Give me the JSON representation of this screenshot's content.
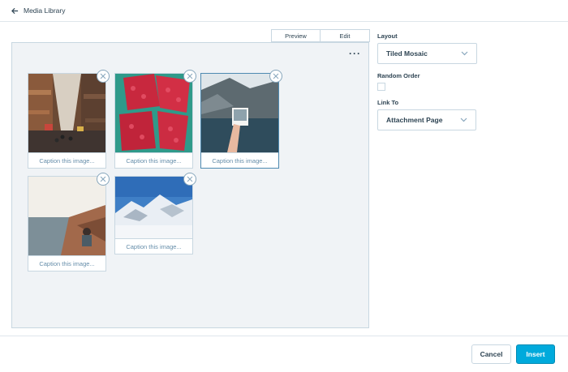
{
  "header": {
    "back_label": "Media Library"
  },
  "tabs": [
    {
      "label": "Preview"
    },
    {
      "label": "Edit"
    }
  ],
  "gallery": {
    "images": [
      {
        "caption_placeholder": "Caption this image...",
        "subject": "narrow-street-photo"
      },
      {
        "caption_placeholder": "Caption this image...",
        "subject": "raspberries-photo"
      },
      {
        "caption_placeholder": "Caption this image...",
        "subject": "lake-polaroid-photo"
      },
      {
        "caption_placeholder": "Caption this image...",
        "subject": "sea-cliff-photo"
      },
      {
        "caption_placeholder": "Caption this image...",
        "subject": "snow-mountain-photo"
      }
    ]
  },
  "settings": {
    "layout_label": "Layout",
    "layout_value": "Tiled Mosaic",
    "random_order_label": "Random Order",
    "random_order_checked": false,
    "link_to_label": "Link To",
    "link_to_value": "Attachment Page"
  },
  "footer": {
    "cancel_label": "Cancel",
    "insert_label": "Insert"
  },
  "colors": {
    "accent": "#00aadc",
    "text": "#2e4453",
    "border": "#c8d7e1",
    "caption": "#668eaa"
  }
}
